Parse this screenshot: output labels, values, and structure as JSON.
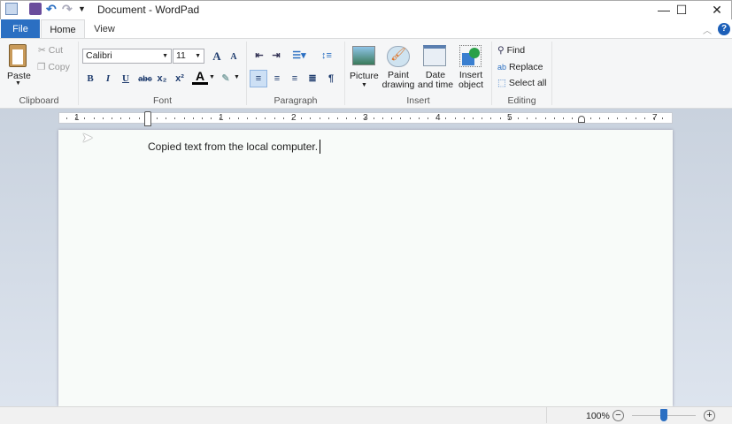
{
  "window": {
    "title": "Document - WordPad",
    "minimize": "—",
    "maximize": "☐",
    "close": "✕"
  },
  "tabs": [
    {
      "label": "File"
    },
    {
      "label": "Home"
    },
    {
      "label": "View"
    }
  ],
  "clipboard": {
    "paste": "Paste",
    "cut": "Cut",
    "copy": "Copy",
    "group": "Clipboard"
  },
  "font": {
    "family": "Calibri",
    "size": "11",
    "group": "Font",
    "bold": "B",
    "italic": "I",
    "underline": "U",
    "strike": "abc",
    "sub": "x₂",
    "sup": "x²",
    "grow": "A",
    "shrink": "A",
    "color": "A"
  },
  "paragraph": {
    "group": "Paragraph"
  },
  "insert": {
    "picture": "Picture",
    "paint": "Paint drawing",
    "datetime": "Date and time",
    "object": "Insert object",
    "group": "Insert"
  },
  "editing": {
    "find": "Find",
    "replace": "Replace",
    "select_all": "Select all",
    "group": "Editing"
  },
  "ruler": {
    "labels": [
      "1",
      "1",
      "2",
      "3",
      "4",
      "5",
      "7"
    ]
  },
  "document": {
    "text": "Copied text from the local computer."
  },
  "status": {
    "zoom": "100%"
  },
  "help": "?"
}
